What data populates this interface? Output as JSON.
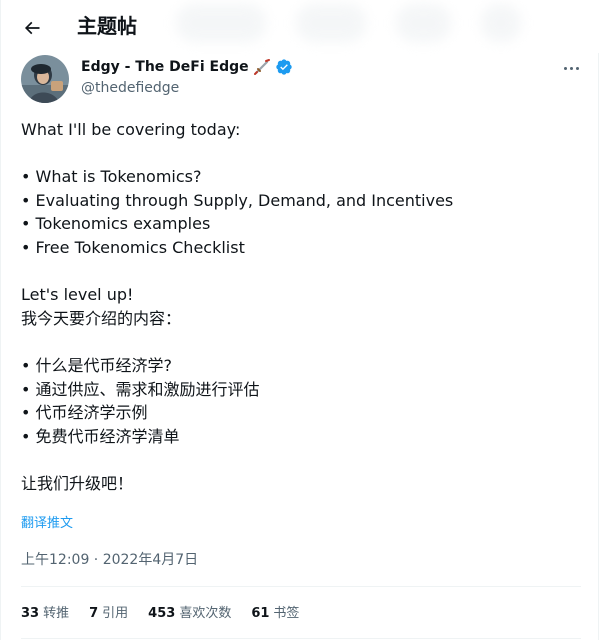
{
  "header": {
    "title": "主题帖"
  },
  "author": {
    "name": "Edgy - The DeFi Edge",
    "handle": "@thedefiedge"
  },
  "tweet": {
    "lines": [
      "What I'll be covering today:",
      "",
      "• What is Tokenomics?",
      "• Evaluating through Supply, Demand, and Incentives",
      "• Tokenomics examples",
      "• Free Tokenomics Checklist",
      "",
      "Let's level up!",
      "我今天要介绍的内容：",
      "",
      "• 什么是代币经济学?",
      "• 通过供应、需求和激励进行评估",
      "• 代币经济学示例",
      "• 免费代币经济学清单",
      "",
      "让我们升级吧！"
    ],
    "translate_label": "翻译推文",
    "timestamp": "上午12:09 · 2022年4月7日"
  },
  "stats": [
    {
      "count": "33",
      "label": "转推"
    },
    {
      "count": "7",
      "label": "引用"
    },
    {
      "count": "453",
      "label": "喜欢次数"
    },
    {
      "count": "61",
      "label": "书签"
    }
  ],
  "colors": {
    "verified": "#1d9bf0",
    "link": "#1d9bf0",
    "secondary_text": "#536471"
  },
  "icons": {
    "back": "arrow-left-icon",
    "emoji": "sword-icon",
    "verified": "verified-badge-icon",
    "more": "more-icon"
  }
}
